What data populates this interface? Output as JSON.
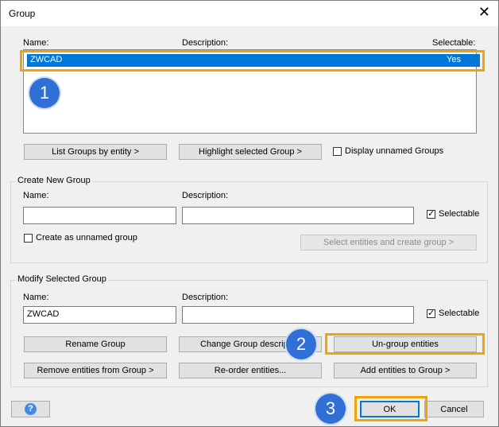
{
  "title": "Group",
  "close_glyph": "✕",
  "groups_list": {
    "col_name": "Name:",
    "col_description": "Description:",
    "col_selectable": "Selectable:",
    "rows": [
      {
        "name": "ZWCAD",
        "selectable": "Yes"
      }
    ]
  },
  "top_buttons": {
    "list_by_entity": "List Groups by entity  >",
    "highlight": "Highlight selected Group  >",
    "display_unnamed": "Display unnamed Groups"
  },
  "create": {
    "legend": "Create New Group",
    "name_label": "Name:",
    "desc_label": "Description:",
    "name_value": "",
    "desc_value": "",
    "selectable_label": "Selectable",
    "selectable_checked": true,
    "unnamed_label": "Create as unnamed group",
    "create_button": "Select entities and create group  >"
  },
  "modify": {
    "legend": "Modify Selected Group",
    "name_label": "Name:",
    "desc_label": "Description:",
    "name_value": "ZWCAD",
    "desc_value": "",
    "selectable_label": "Selectable",
    "selectable_checked": true,
    "rename": "Rename Group",
    "change_desc": "Change Group descript",
    "ungroup": "Un-group entities",
    "remove": "Remove entities from Group  >",
    "reorder": "Re-order entities...",
    "add": "Add entities to Group  >"
  },
  "footer": {
    "help_icon": "?",
    "ok": "OK",
    "cancel": "Cancel"
  },
  "callouts": [
    "1",
    "2",
    "3"
  ],
  "colors": {
    "accent": "#0078d7",
    "highlight": "#f0a30a",
    "badge": "#2f6fd6"
  }
}
